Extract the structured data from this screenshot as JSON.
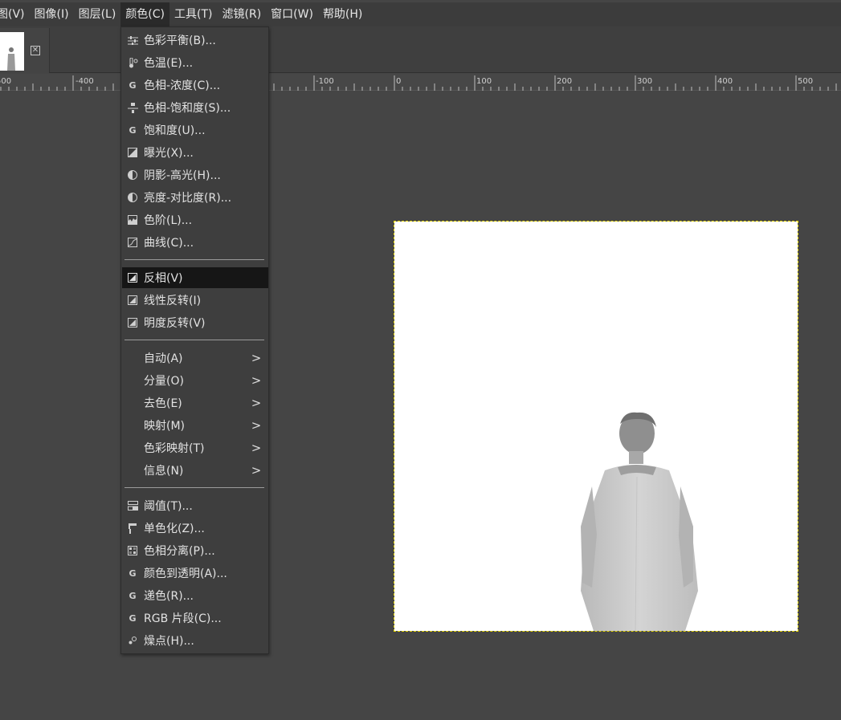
{
  "menubar": {
    "items": [
      {
        "label": "图(V)"
      },
      {
        "label": "图像(I)"
      },
      {
        "label": "图层(L)"
      },
      {
        "label": "颜色(C)"
      },
      {
        "label": "工具(T)"
      },
      {
        "label": "滤镜(R)"
      },
      {
        "label": "窗口(W)"
      },
      {
        "label": "帮助(H)"
      }
    ],
    "active": "颜色(C)"
  },
  "ruler": {
    "labels": [
      "500",
      "-400",
      "-100",
      "0",
      "100",
      "200",
      "300",
      "400",
      "500"
    ]
  },
  "color_menu": {
    "items": [
      {
        "label": "色彩平衡(B)...",
        "icon": "color-balance-icon"
      },
      {
        "label": "色温(E)...",
        "icon": "thermometer-icon"
      },
      {
        "label": "色相-浓度(C)...",
        "icon": "gegl-icon"
      },
      {
        "label": "色相-饱和度(S)...",
        "icon": "hue-saturation-icon"
      },
      {
        "label": "饱和度(U)...",
        "icon": "gegl-icon"
      },
      {
        "label": "曝光(X)...",
        "icon": "exposure-icon"
      },
      {
        "label": "阴影-高光(H)...",
        "icon": "shadows-highlights-icon"
      },
      {
        "label": "亮度-对比度(R)...",
        "icon": "brightness-contrast-icon"
      },
      {
        "label": "色阶(L)...",
        "icon": "levels-icon"
      },
      {
        "label": "曲线(C)...",
        "icon": "curves-icon"
      },
      {
        "label": "反相(V)",
        "icon": "invert-icon",
        "highlighted": true
      },
      {
        "label": "线性反转(I)",
        "icon": "invert-icon"
      },
      {
        "label": "明度反转(V)",
        "icon": "invert-icon"
      },
      {
        "label": "自动(A)",
        "submenu": true
      },
      {
        "label": "分量(O)",
        "submenu": true
      },
      {
        "label": "去色(E)",
        "submenu": true
      },
      {
        "label": "映射(M)",
        "submenu": true
      },
      {
        "label": "色彩映射(T)",
        "submenu": true
      },
      {
        "label": "信息(N)",
        "submenu": true
      },
      {
        "label": "阈值(T)...",
        "icon": "threshold-icon"
      },
      {
        "label": "单色化(Z)...",
        "icon": "colorize-icon"
      },
      {
        "label": "色相分离(P)...",
        "icon": "posterize-icon"
      },
      {
        "label": "颜色到透明(A)...",
        "icon": "gegl-icon"
      },
      {
        "label": "递色(R)...",
        "icon": "gegl-icon"
      },
      {
        "label": "RGB 片段(C)...",
        "icon": "gegl-icon"
      },
      {
        "label": "燥点(H)...",
        "icon": "hot-pixels-icon"
      }
    ],
    "submenu_arrow": ">"
  },
  "colors": {
    "background": "#454545",
    "menubar": "#3c3c3c",
    "menu_bg": "#3e3e3e",
    "highlight": "#161616",
    "selection": "#e8d80a",
    "canvas": "#ffffff"
  }
}
